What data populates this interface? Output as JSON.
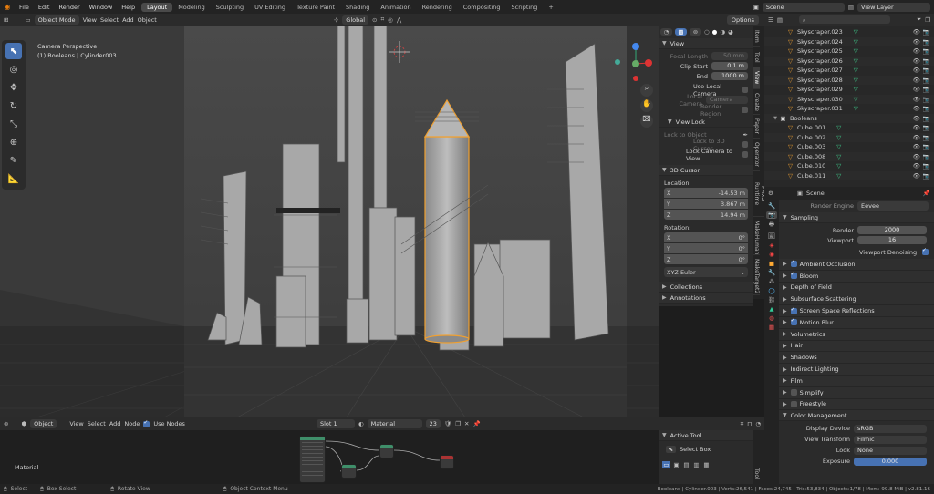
{
  "topbar": {
    "menus": [
      "File",
      "Edit",
      "Render",
      "Window",
      "Help"
    ],
    "workspaces": [
      "Layout",
      "Modeling",
      "Sculpting",
      "UV Editing",
      "Texture Paint",
      "Shading",
      "Animation",
      "Rendering",
      "Compositing",
      "Scripting"
    ],
    "active_workspace": "Layout",
    "add_tab": "+",
    "scene": "Scene",
    "view_layer": "View Layer"
  },
  "viewport_header": {
    "mode": "Object Mode",
    "menus": [
      "View",
      "Select",
      "Add",
      "Object"
    ],
    "orientation": "Global",
    "options": "Options"
  },
  "viewport": {
    "camera_label": "Camera Perspective",
    "object_label": "(1) Booleans | Cylinder003"
  },
  "npanel": {
    "view": {
      "title": "View",
      "focal_length_label": "Focal Length",
      "focal_length": "50 mm",
      "clip_start_label": "Clip Start",
      "clip_start": "0.1 m",
      "end_label": "End",
      "end": "1000 m",
      "use_local_camera": "Use Local Camera",
      "local_camera_label": "Local Camera",
      "local_camera_value": "Camera",
      "render_region": "Render Region"
    },
    "view_lock": {
      "title": "View Lock",
      "lock_to_object": "Lock to Object",
      "lock_to_cursor": "Lock to 3D Cursor",
      "lock_camera": "Lock Camera to View"
    },
    "cursor": {
      "title": "3D Cursor",
      "location_label": "Location:",
      "x_label": "X",
      "x": "-14.53 m",
      "y_label": "Y",
      "y": "3.867 m",
      "z_label": "Z",
      "z": "14.94 m",
      "rotation_label": "Rotation:",
      "rx": "0°",
      "ry": "0°",
      "rz": "0°",
      "euler": "XYZ Euler"
    },
    "collections": "Collections",
    "annotations": "Annotations",
    "tabs": [
      "Item",
      "Tool",
      "View",
      "Create",
      "Paper",
      "Operator",
      "FMX2 Runtime",
      "MakeHuman",
      "MakeTarget2"
    ]
  },
  "outliner": {
    "rows": [
      {
        "name": "Skyscraper.023",
        "indent": 2
      },
      {
        "name": "Skyscraper.024",
        "indent": 2
      },
      {
        "name": "Skyscraper.025",
        "indent": 2
      },
      {
        "name": "Skyscraper.026",
        "indent": 2
      },
      {
        "name": "Skyscraper.027",
        "indent": 2
      },
      {
        "name": "Skyscraper.028",
        "indent": 2
      },
      {
        "name": "Skyscraper.029",
        "indent": 2
      },
      {
        "name": "Skyscraper.030",
        "indent": 2
      },
      {
        "name": "Skyscraper.031",
        "indent": 2
      },
      {
        "name": "Booleans",
        "indent": 1,
        "collection": true
      },
      {
        "name": "Cube.001",
        "indent": 2
      },
      {
        "name": "Cube.002",
        "indent": 2
      },
      {
        "name": "Cube.003",
        "indent": 2
      },
      {
        "name": "Cube.008",
        "indent": 2
      },
      {
        "name": "Cube.010",
        "indent": 2
      },
      {
        "name": "Cube.011",
        "indent": 2
      }
    ]
  },
  "properties": {
    "scene_label": "Scene",
    "render_engine_label": "Render Engine",
    "render_engine": "Eevee",
    "sampling": "Sampling",
    "render_label": "Render",
    "render_samples": "2000",
    "viewport_label": "Viewport",
    "viewport_samples": "16",
    "viewport_denoising": "Viewport Denoising",
    "sections": [
      {
        "label": "Ambient Occlusion",
        "check": true
      },
      {
        "label": "Bloom",
        "check": true
      },
      {
        "label": "Depth of Field",
        "check": null
      },
      {
        "label": "Subsurface Scattering",
        "check": null
      },
      {
        "label": "Screen Space Reflections",
        "check": true
      },
      {
        "label": "Motion Blur",
        "check": true
      },
      {
        "label": "Volumetrics",
        "check": null
      },
      {
        "label": "Hair",
        "check": null
      },
      {
        "label": "Shadows",
        "check": null
      },
      {
        "label": "Indirect Lighting",
        "check": null
      },
      {
        "label": "Film",
        "check": null
      },
      {
        "label": "Simplify",
        "check": false
      },
      {
        "label": "Freestyle",
        "check": false
      }
    ],
    "color_management": "Color Management",
    "display_device_label": "Display Device",
    "display_device": "sRGB",
    "view_transform_label": "View Transform",
    "view_transform": "Filmic",
    "look_label": "Look",
    "look": "None",
    "exposure_label": "Exposure",
    "exposure": "0.000"
  },
  "node_editor": {
    "type": "Object",
    "menus": [
      "View",
      "Select",
      "Add",
      "Node"
    ],
    "use_nodes": "Use Nodes",
    "slot": "Slot 1",
    "material": "Material",
    "users": "23",
    "material_label": "Material"
  },
  "active_tool": {
    "title": "Active Tool",
    "tool": "Select Box",
    "tab": "Tool"
  },
  "statusbar": {
    "select": "Select",
    "box_select": "Box Select",
    "rotate_view": "Rotate View",
    "context_menu": "Object Context Menu",
    "stats": "Booleans | Cylinder.003 | Verts:26,541 | Faces:24,745 | Tris:53,834 | Objects:1/78 | Mem: 99.8 MiB | v2.81.16"
  },
  "colors": {
    "accent": "#4772b3",
    "selection_orange": "#f0a030",
    "mesh_triangle": "#3fcf8e"
  }
}
